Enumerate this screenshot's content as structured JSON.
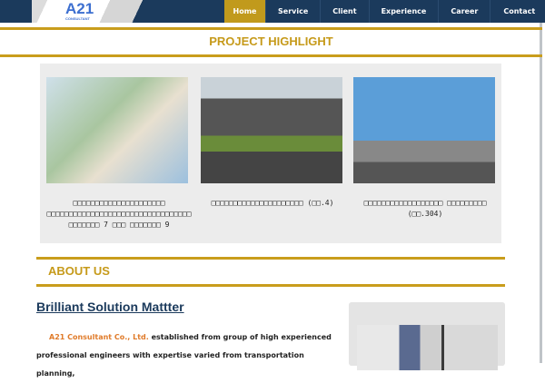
{
  "logo": {
    "main": "A21",
    "sub": "CONSULTANT"
  },
  "nav": [
    "Home",
    "Service",
    "Client",
    "Experience",
    "Career",
    "Contact"
  ],
  "project": {
    "title": "PROJECT HIGHLIGHT",
    "items": [
      {
        "caption": "□□□□□□□□□□□□□□□□□□□□□ □□□□□□□□□□□□□□□□□□□□□□□□□□□□□□□□□ □□□□□□□ 7 □□□ □□□□□□□ 9"
      },
      {
        "caption": "□□□□□□□□□□□□□□□□□□□□□ (□□.4)"
      },
      {
        "caption": "□□□□□□□□□□□□□□□□□□ □□□□□□□□□ (□□.304)"
      }
    ]
  },
  "about": {
    "title": "ABOUT US",
    "heading": "Brilliant Solution Mattter",
    "company": "A21 Consultant Co., Ltd.",
    "text": " established from group of high experienced professional engineers with expertise varied from transportation planning,"
  }
}
